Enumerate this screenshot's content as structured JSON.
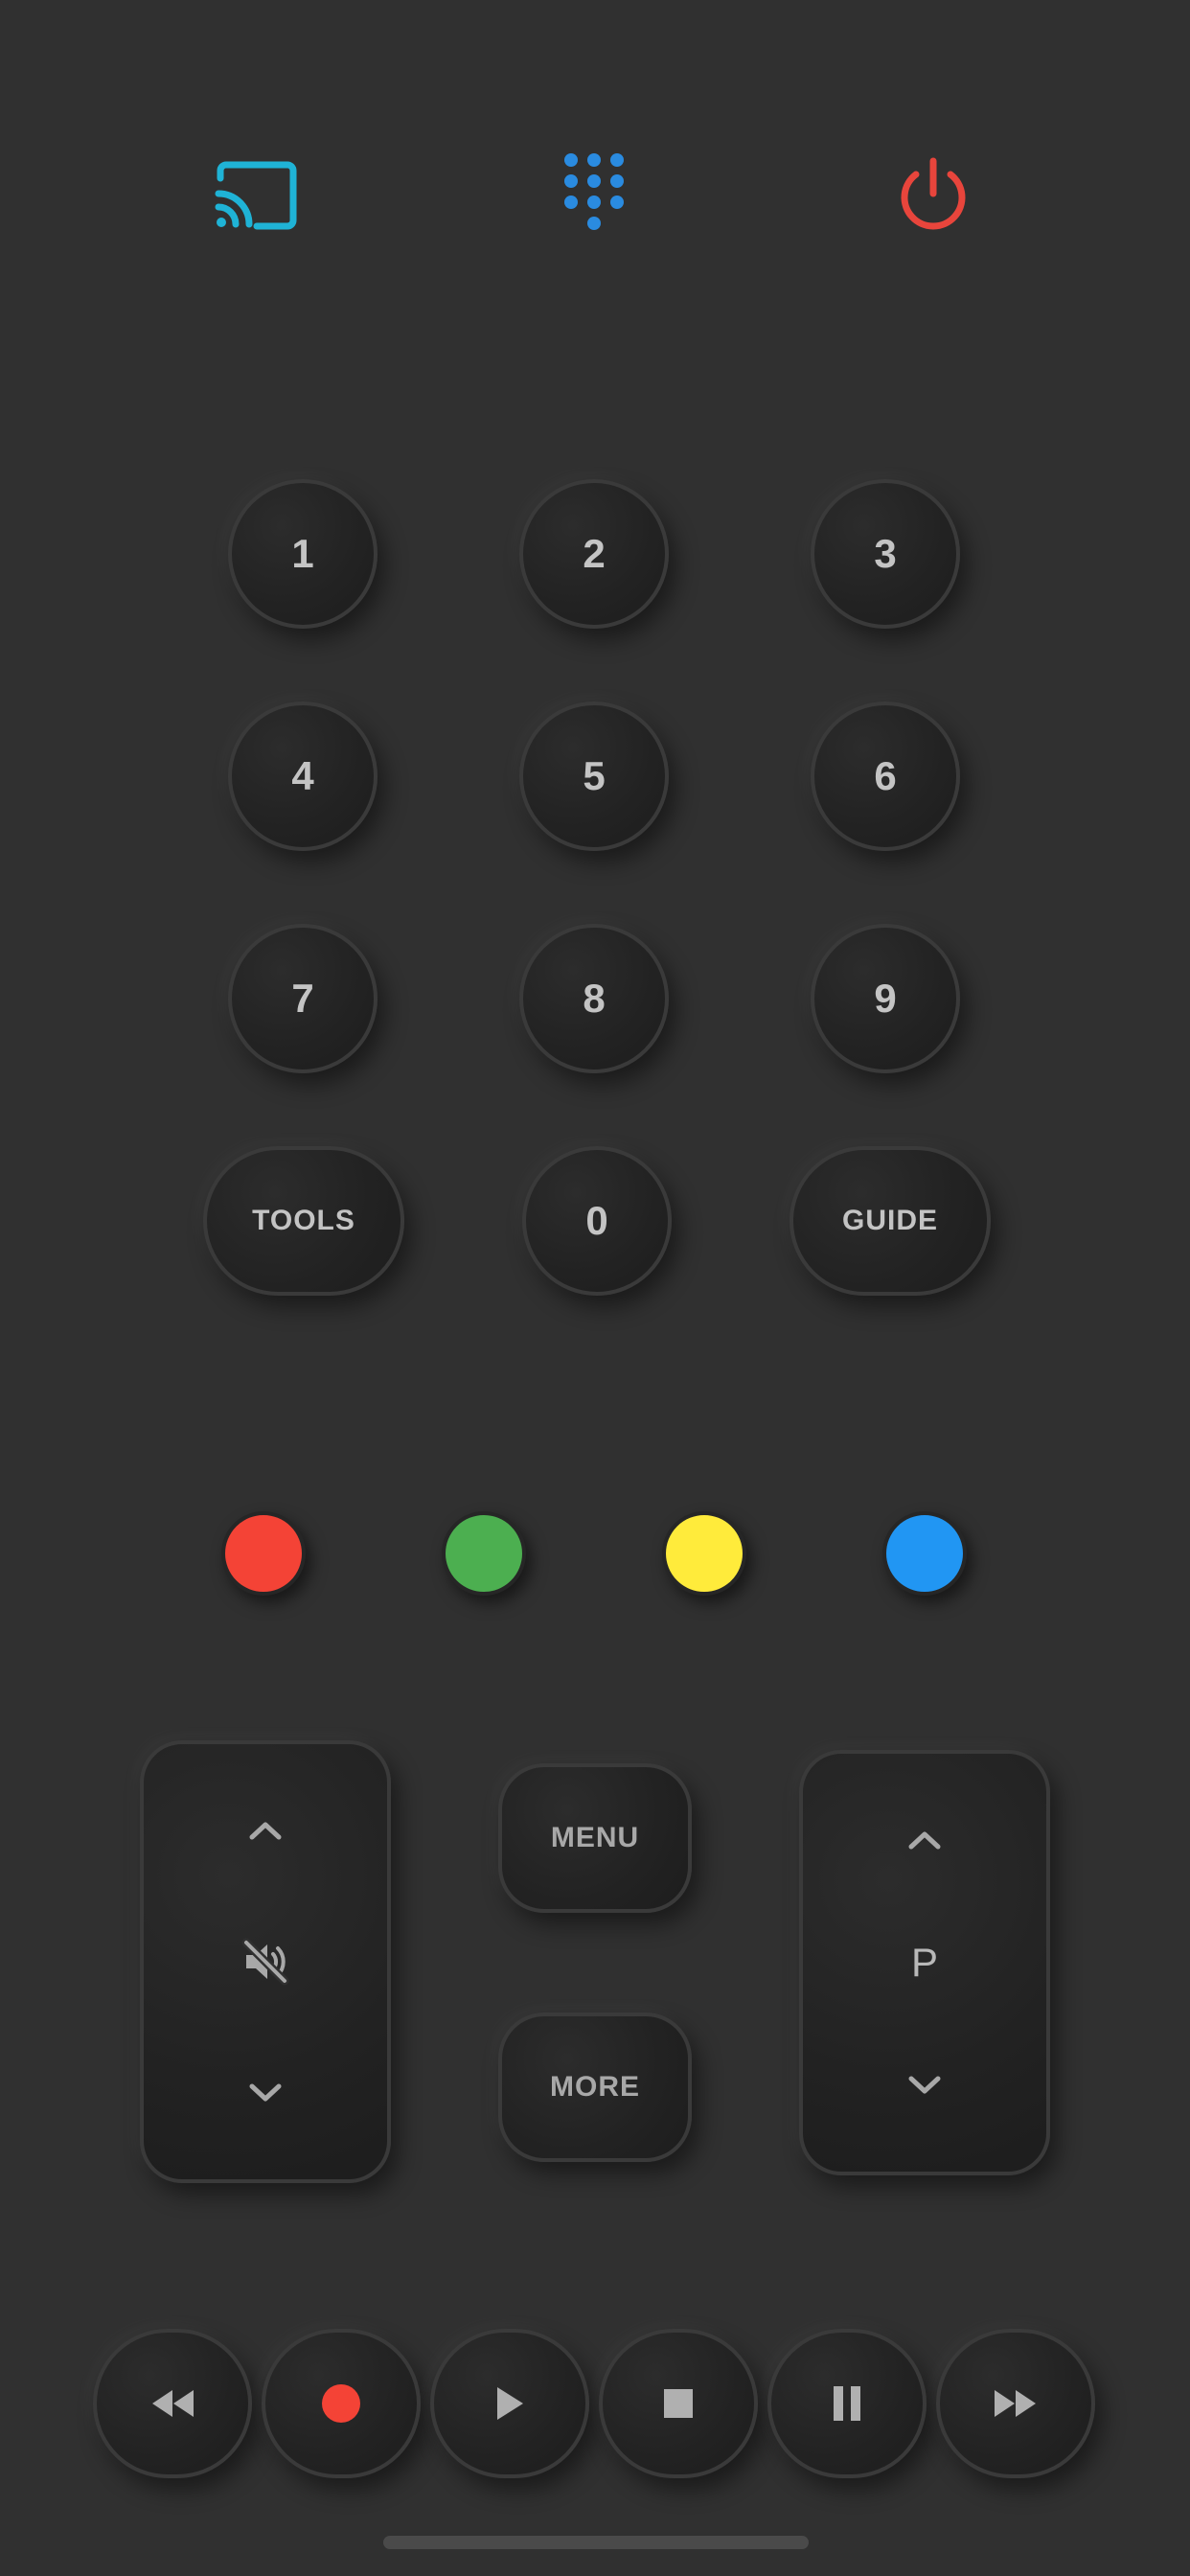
{
  "top_bar": {
    "cast_icon": "cast-icon",
    "keypad_icon": "keypad-icon",
    "power_icon": "power-icon",
    "colors": {
      "cast": "#1fb3d6",
      "keypad": "#2a8be0",
      "power": "#e8453c"
    }
  },
  "keypad": {
    "keys": [
      "1",
      "2",
      "3",
      "4",
      "5",
      "6",
      "7",
      "8",
      "9",
      "0"
    ],
    "tools_label": "TOOLS",
    "guide_label": "GUIDE"
  },
  "color_buttons": {
    "red": "#f44336",
    "green": "#4caf50",
    "yellow": "#ffeb3b",
    "blue": "#2196f3"
  },
  "controls": {
    "volume_up_icon": "chevron-up-icon",
    "mute_icon": "mute-icon",
    "volume_down_icon": "chevron-down-icon",
    "menu_label": "MENU",
    "more_label": "MORE",
    "channel_label": "P",
    "channel_up_icon": "chevron-up-icon",
    "channel_down_icon": "chevron-down-icon"
  },
  "media": {
    "icons": [
      "rewind-icon",
      "record-icon",
      "play-icon",
      "stop-icon",
      "pause-icon",
      "fast-forward-icon"
    ],
    "record_color": "#f44336"
  }
}
